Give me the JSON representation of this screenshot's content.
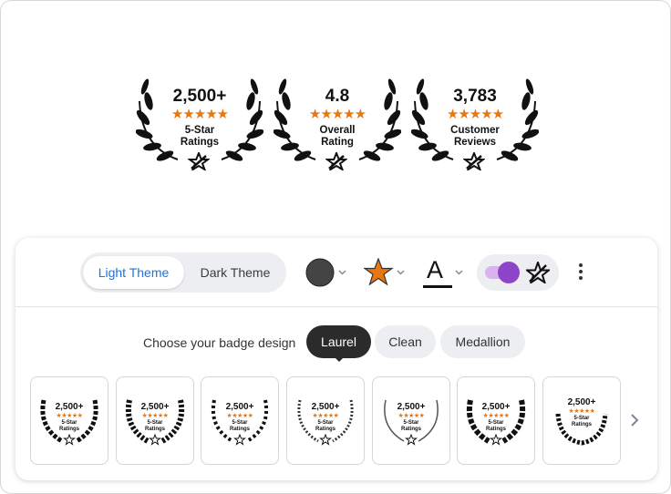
{
  "preview_badges": [
    {
      "number": "2,500+",
      "stars": "★★★★★",
      "label_line1": "5-Star",
      "label_line2": "Ratings"
    },
    {
      "number": "4.8",
      "stars": "★★★★★",
      "label_line1": "Overall",
      "label_line2": "Rating"
    },
    {
      "number": "3,783",
      "stars": "★★★★★",
      "label_line1": "Customer",
      "label_line2": "Reviews"
    }
  ],
  "toolbar": {
    "theme_light_label": "Light Theme",
    "theme_dark_label": "Dark Theme",
    "text_color_glyph": "A",
    "colors": {
      "badge_color": "#444444",
      "star_color": "#e8770f",
      "text_color": "#111111",
      "toggle_accent": "#8e44c9",
      "active_theme_text": "#1a73e8"
    },
    "icons": [
      "color-swatch-icon",
      "star-icon",
      "text-color-icon",
      "star-logo-icon",
      "more-vert-icon",
      "chevron-down-icon"
    ]
  },
  "design_chooser": {
    "prompt": "Choose your badge design",
    "options": [
      "Laurel",
      "Clean",
      "Medallion"
    ],
    "selected": "Laurel"
  },
  "thumbnails": [
    {
      "number": "2,500+",
      "stars": "★★★★★",
      "label_line1": "5-Star",
      "label_line2": "Ratings"
    },
    {
      "number": "2,500+",
      "stars": "★★★★★",
      "label_line1": "5-Star",
      "label_line2": "Ratings"
    },
    {
      "number": "2,500+",
      "stars": "★★★★★",
      "label_line1": "5-Star",
      "label_line2": "Ratings"
    },
    {
      "number": "2,500+",
      "stars": "★★★★★",
      "label_line1": "5-Star",
      "label_line2": "Ratings"
    },
    {
      "number": "2,500+",
      "stars": "★★★★★",
      "label_line1": "5-Star",
      "label_line2": "Ratings"
    },
    {
      "number": "2,500+",
      "stars": "★★★★★",
      "label_line1": "5-Star",
      "label_line2": "Ratings"
    },
    {
      "number": "2,500+",
      "stars": "★★★★★",
      "label_line1": "5-Star",
      "label_line2": "Ratings"
    }
  ]
}
